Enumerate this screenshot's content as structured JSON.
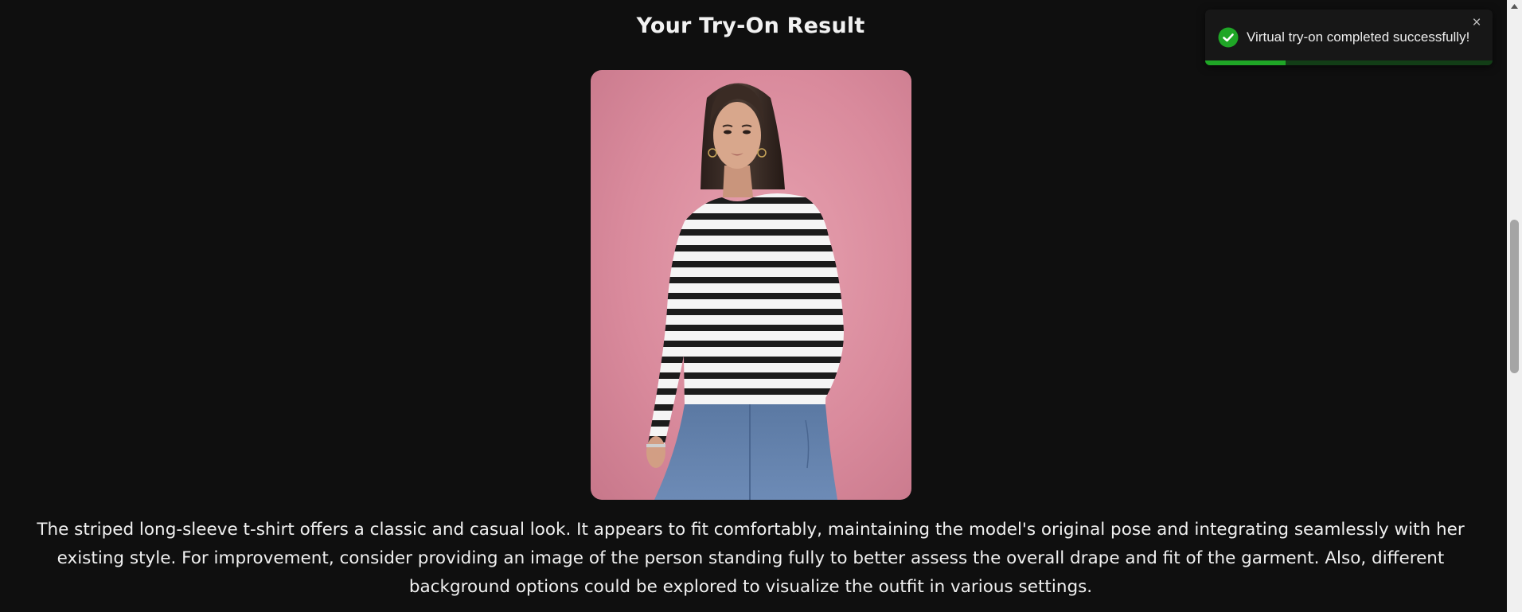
{
  "result": {
    "title": "Your Try-On Result",
    "image_alt": "Try-on result photo: woman wearing a striped long-sleeve t-shirt and jeans against a pink background",
    "description": "The striped long-sleeve t-shirt offers a classic and casual look. It appears to fit comfortably, maintaining the model's original pose and integrating seamlessly with her existing style. For improvement, consider providing an image of the person standing fully to better assess the overall drape and fit of the garment. Also, different background options could be explored to visualize the outfit in various settings."
  },
  "toast": {
    "message": "Virtual try-on completed successfully!",
    "close_symbol": "×",
    "icon": "check-circle-icon",
    "progress_percent": 28,
    "colors": {
      "success": "#1fa626",
      "track": "#123d16"
    }
  },
  "colors": {
    "background": "#0f0f0f",
    "photo_background": "#d98a9c"
  }
}
